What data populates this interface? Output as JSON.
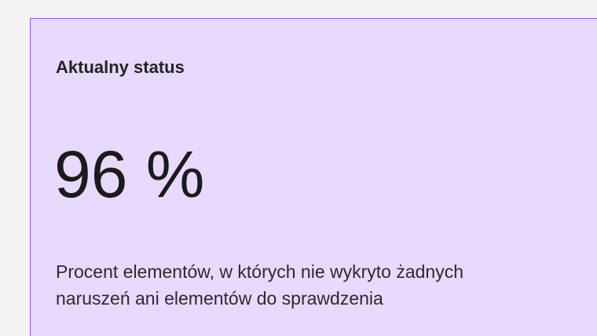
{
  "status_card": {
    "title": "Aktualny status",
    "value": "96 %",
    "description_line_1": "Procent elementów, w których nie wykryto żadnych",
    "description_line_2": "naruszeń ani elementów do sprawdzenia"
  },
  "colors": {
    "page_background": "#f3f3f3",
    "card_background": "#e8d9ff",
    "card_border": "#8b5cf6",
    "text": "#1f1f1f"
  }
}
